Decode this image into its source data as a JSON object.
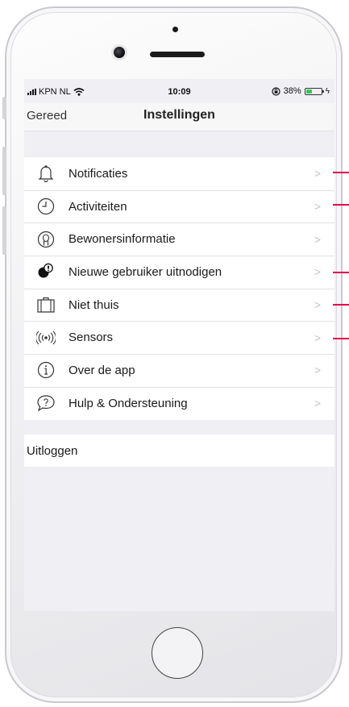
{
  "status_bar": {
    "carrier": "KPN NL",
    "time": "10:09",
    "battery": "38%",
    "battery_level": 0.38
  },
  "nav": {
    "left_label": "Gereed",
    "title": "Instellingen"
  },
  "menu": [
    {
      "label": "Notificaties",
      "icon": "bell-icon",
      "chevron": ">"
    },
    {
      "label": "Activiteiten",
      "icon": "clock-icon",
      "chevron": ">"
    },
    {
      "label": "Bewonersinformatie",
      "icon": "person-circle-icon",
      "chevron": ">"
    },
    {
      "label": "Nieuwe gebruiker uitnodigen",
      "icon": "invite-user-icon",
      "chevron": ">"
    },
    {
      "label": "Niet thuis",
      "icon": "suitcase-icon",
      "chevron": ">"
    },
    {
      "label": "Sensors",
      "icon": "sensor-signal-icon",
      "chevron": ">"
    },
    {
      "label": "Over de app",
      "icon": "info-icon",
      "chevron": ">"
    },
    {
      "label": "Hulp & Ondersteuning",
      "icon": "help-chat-icon",
      "chevron": ">"
    }
  ],
  "logout": {
    "label": "Uitloggen"
  },
  "colors": {
    "accent_marker": "#e3004f",
    "battery_fill": "#34c759"
  }
}
